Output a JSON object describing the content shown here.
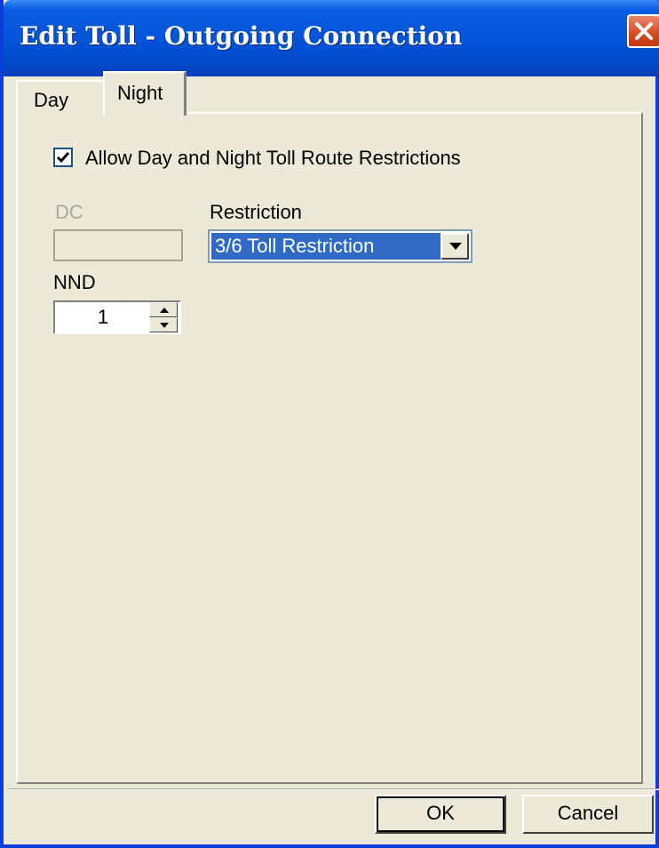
{
  "window": {
    "title": "Edit Toll - Outgoing Connection"
  },
  "tabs": [
    {
      "label": "Day",
      "selected": false
    },
    {
      "label": "Night",
      "selected": true
    }
  ],
  "form": {
    "allow_checkbox": {
      "label": "Allow Day and Night Toll Route Restrictions",
      "checked": true
    },
    "dc": {
      "label": "DC",
      "value": "",
      "enabled": false
    },
    "restriction": {
      "label": "Restriction",
      "value": "3/6 Toll Restriction"
    },
    "nnd": {
      "label": "NND",
      "value": "1"
    }
  },
  "buttons": {
    "ok": "OK",
    "cancel": "Cancel"
  },
  "colors": {
    "titlebar": "#0553d8",
    "selection": "#316ac5",
    "close_button": "#d34a1f",
    "disabled_text": "#a8a89a"
  },
  "icons": {
    "close": "close-icon",
    "check": "check-icon",
    "dropdown": "chevron-down-icon",
    "spin_up": "spin-up-icon",
    "spin_down": "spin-down-icon"
  }
}
